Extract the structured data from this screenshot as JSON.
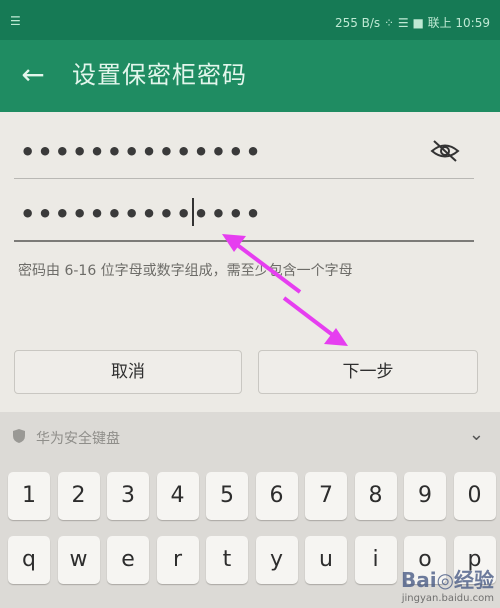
{
  "status_bar": {
    "left_indicator": "☰",
    "right_text": "255 B/s  ⁘  ☰  ■  联上 10:59"
  },
  "app_bar": {
    "back_icon": "arrow-left",
    "title": "设置保密柜密码"
  },
  "form": {
    "password_value": "••••••••••••••",
    "confirm_value": "••••••••••••••",
    "hint": "密码由 6-16 位字母或数字组成，需至少包含一个字母",
    "cancel_label": "取消",
    "next_label": "下一步"
  },
  "keyboard": {
    "header_label": "华为安全键盘",
    "collapse_icon": "chevron-down",
    "number_keys": [
      "1",
      "2",
      "3",
      "4",
      "5",
      "6",
      "7",
      "8",
      "9",
      "0"
    ],
    "letter_keys": [
      "q",
      "w",
      "e",
      "r",
      "t",
      "y",
      "u",
      "i",
      "o",
      "p"
    ]
  },
  "watermark": {
    "brand": "Bai◎经验",
    "url": "jingyan.baidu.com"
  },
  "colors": {
    "app_bar": "#1f8c62",
    "status_bar": "#167a55",
    "annotation_arrow": "#e63ef0"
  }
}
